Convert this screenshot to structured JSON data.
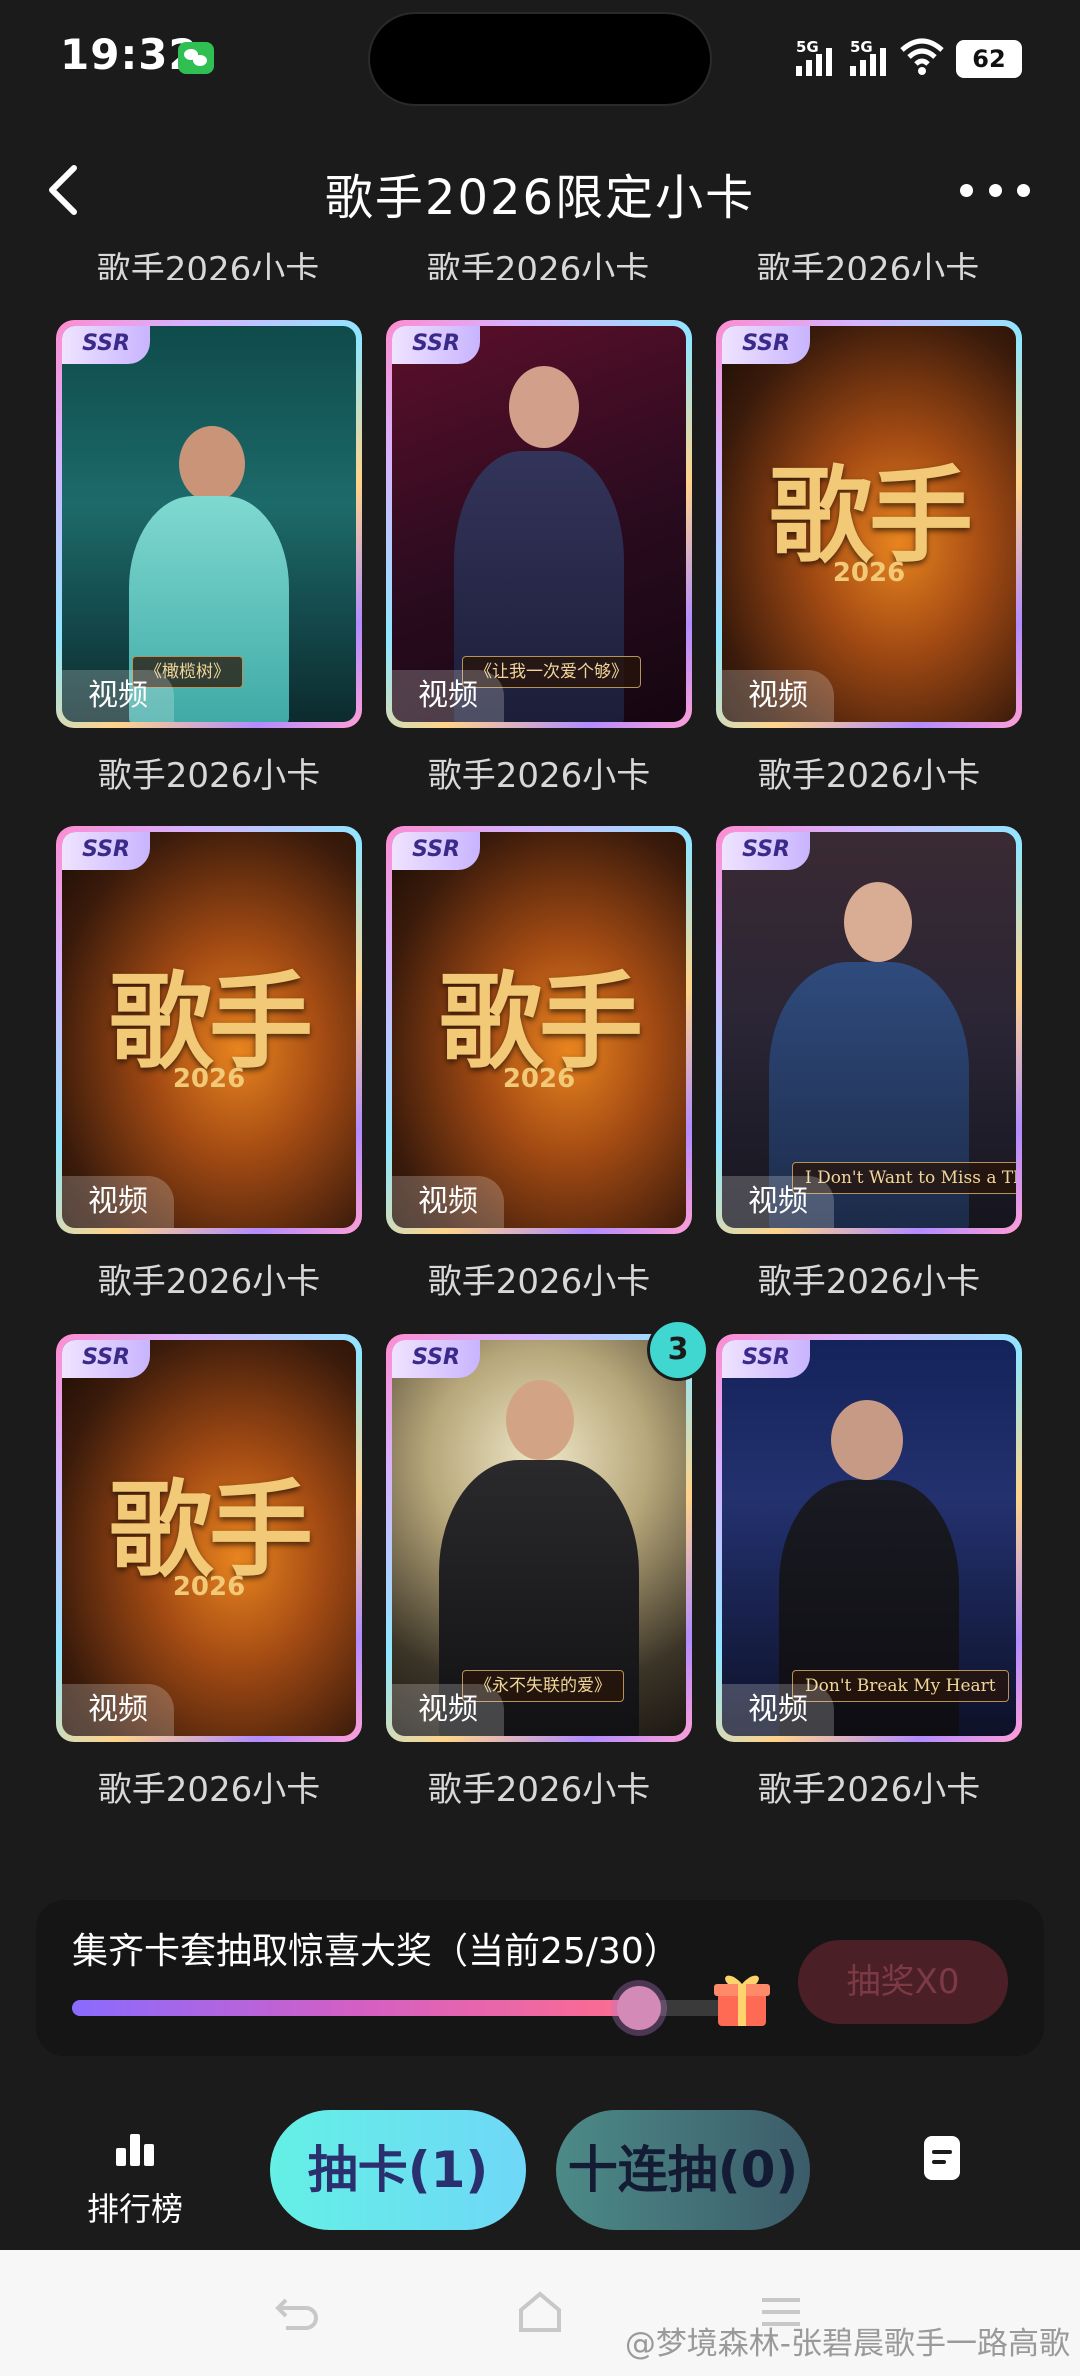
{
  "status_bar": {
    "time": "19:32",
    "signal1": "5G",
    "signal2": "5G",
    "battery": "62"
  },
  "header": {
    "title": "歌手2026限定小卡"
  },
  "top_labels": [
    "歌手2026小卡",
    "歌手2026小卡",
    "歌手2026小卡"
  ],
  "cards": [
    {
      "caption": "歌手2026小卡",
      "rarity": "SSR",
      "tag": "视频",
      "song": "《橄榄树》"
    },
    {
      "caption": "歌手2026小卡",
      "rarity": "SSR",
      "tag": "视频",
      "song": "《让我一次爱个够》"
    },
    {
      "caption": "歌手2026小卡",
      "rarity": "SSR",
      "tag": "视频",
      "logo": "歌手",
      "year": "2026"
    },
    {
      "caption": "歌手2026小卡",
      "rarity": "SSR",
      "tag": "视频",
      "logo": "歌手",
      "year": "2026"
    },
    {
      "caption": "歌手2026小卡",
      "rarity": "SSR",
      "tag": "视频",
      "logo": "歌手",
      "year": "2026"
    },
    {
      "caption": "歌手2026小卡",
      "rarity": "SSR",
      "tag": "视频",
      "song": "I Don't Want to Miss a Thing"
    },
    {
      "caption": "歌手2026小卡",
      "rarity": "SSR",
      "tag": "视频",
      "logo": "歌手",
      "year": "2026"
    },
    {
      "caption": "歌手2026小卡",
      "rarity": "SSR",
      "tag": "视频",
      "song": "《永不失联的爱》",
      "count": "3"
    },
    {
      "caption": "歌手2026小卡",
      "rarity": "SSR",
      "tag": "视频",
      "song": "Don't Break My Heart"
    }
  ],
  "progress": {
    "text": "集齐卡套抽取惊喜大奖（当前25/30）",
    "current": 25,
    "total": 30,
    "draw_button": "抽奖X0"
  },
  "bottom_nav": {
    "rank_label": "排行榜",
    "draw_one": "抽卡(1)",
    "draw_ten": "十连抽(0)"
  },
  "watermark": "@梦境森林-张碧晨歌手一路高歌",
  "colors": {
    "accent_cyan": "#64f0e5",
    "background": "#1b1b1c",
    "progress_pink": "#d35fc5"
  }
}
